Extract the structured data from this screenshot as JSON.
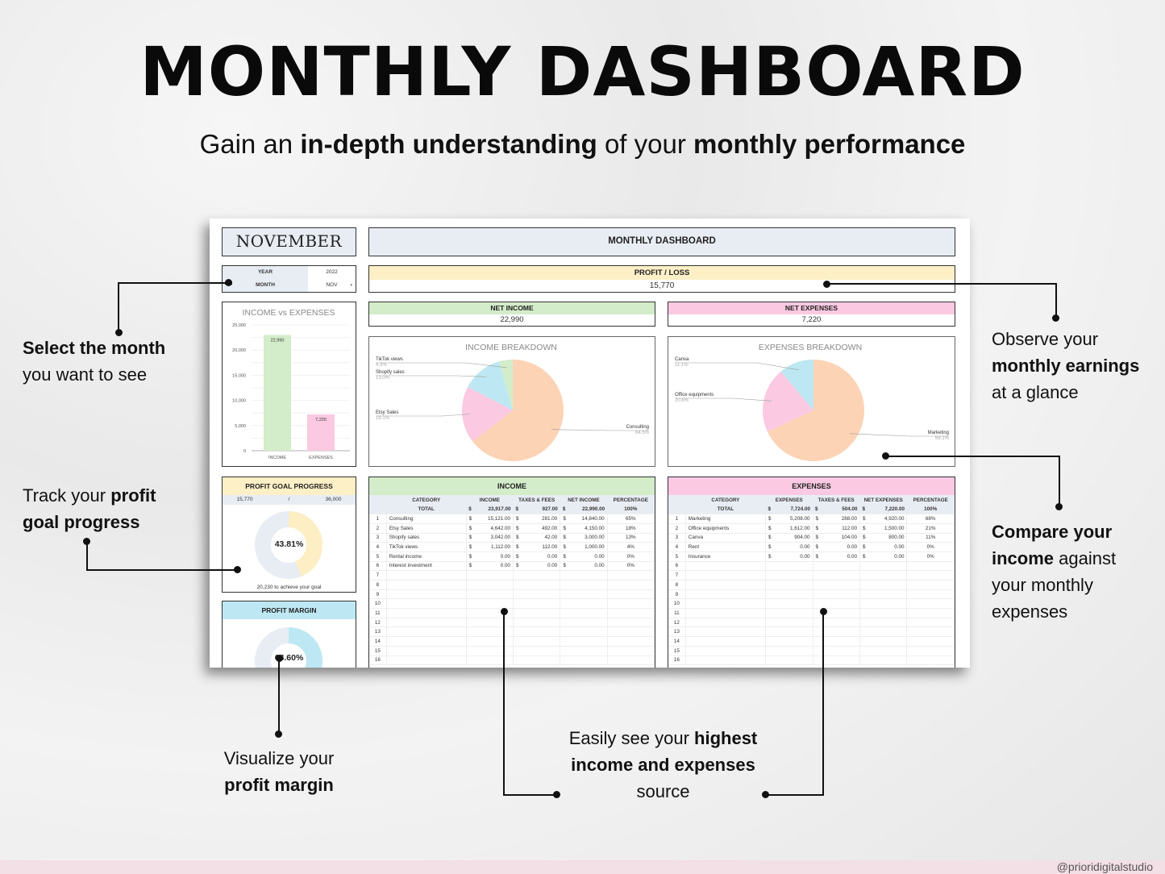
{
  "header": {
    "title": "MONTHLY DASHBOARD",
    "subtitle_parts": [
      {
        "text": "Gain an ",
        "bold": false
      },
      {
        "text": "in-depth understanding",
        "bold": true
      },
      {
        "text": " of your ",
        "bold": false
      },
      {
        "text": "monthly performance",
        "bold": true
      }
    ]
  },
  "dashboard": {
    "month_display": "NOVEMBER",
    "selector": {
      "year_label": "YEAR",
      "year_value": "2022",
      "month_label": "MONTH",
      "month_value": "NOV",
      "dropdown_icon": "▾"
    },
    "title": "MONTHLY DASHBOARD",
    "profit_loss": {
      "label": "PROFIT / LOSS",
      "value": "15,770"
    },
    "net_income": {
      "label": "NET INCOME",
      "value": "22,990"
    },
    "net_expenses": {
      "label": "NET EXPENSES",
      "value": "7,220"
    },
    "profit_goal": {
      "label": "PROFIT GOAL PROGRESS",
      "current": "15,770",
      "separator": "/",
      "goal": "36,000",
      "percent_label": "43.81%",
      "fraction": 0.4381,
      "remaining_text": "20,230  to achieve your goal",
      "fill_color": "#fdeec4",
      "track_color": "#e8edf4"
    },
    "profit_margin": {
      "label": "PROFIT MARGIN",
      "percent_label": "68.60%",
      "fraction": 0.686,
      "fill_color": "#bde8f3",
      "track_color": "#e8edf4"
    },
    "income_table": {
      "title": "INCOME",
      "columns": [
        "CATEGORY",
        "INCOME",
        "TAXES & FEES",
        "NET INCOME",
        "PERCENTAGE"
      ],
      "total": {
        "label": "TOTAL",
        "income": "23,917.00",
        "taxes": "927.00",
        "net": "22,990.00",
        "pct": "100%"
      },
      "rows": [
        {
          "n": "1",
          "category": "Consulting",
          "income": "15,121.00",
          "taxes": "281.00",
          "net": "14,840.00",
          "pct": "65%"
        },
        {
          "n": "2",
          "category": "Etsy Sales",
          "income": "4,642.00",
          "taxes": "492.00",
          "net": "4,150.00",
          "pct": "18%"
        },
        {
          "n": "3",
          "category": "Shopify sales",
          "income": "3,042.00",
          "taxes": "42.00",
          "net": "3,000.00",
          "pct": "13%"
        },
        {
          "n": "4",
          "category": "TikTok views",
          "income": "1,112.00",
          "taxes": "112.00",
          "net": "1,000.00",
          "pct": "4%"
        },
        {
          "n": "5",
          "category": "Rental income",
          "income": "0.00",
          "taxes": "0.00",
          "net": "0.00",
          "pct": "0%"
        },
        {
          "n": "6",
          "category": "Interest investment",
          "income": "0.00",
          "taxes": "0.00",
          "net": "0.00",
          "pct": "0%"
        },
        {
          "n": "7"
        },
        {
          "n": "8"
        },
        {
          "n": "9"
        },
        {
          "n": "10"
        },
        {
          "n": "11"
        },
        {
          "n": "12"
        },
        {
          "n": "13"
        },
        {
          "n": "14"
        },
        {
          "n": "15"
        },
        {
          "n": "16"
        }
      ]
    },
    "expenses_table": {
      "title": "EXPENSES",
      "columns": [
        "CATEGORY",
        "EXPENSES",
        "TAXES & FEES",
        "NET EXPENSES",
        "PERCENTAGE"
      ],
      "total": {
        "label": "TOTAL",
        "income": "7,724.00",
        "taxes": "504.00",
        "net": "7,220.00",
        "pct": "100%"
      },
      "rows": [
        {
          "n": "1",
          "category": "Marketing",
          "income": "5,208.00",
          "taxes": "288.00",
          "net": "4,920.00",
          "pct": "68%"
        },
        {
          "n": "2",
          "category": "Office equipments",
          "income": "1,612.00",
          "taxes": "112.00",
          "net": "1,500.00",
          "pct": "21%"
        },
        {
          "n": "3",
          "category": "Canva",
          "income": "904.00",
          "taxes": "104.00",
          "net": "800.00",
          "pct": "11%"
        },
        {
          "n": "4",
          "category": "Rent",
          "income": "0.00",
          "taxes": "0.00",
          "net": "0.00",
          "pct": "0%"
        },
        {
          "n": "5",
          "category": "Insurance",
          "income": "0.00",
          "taxes": "0.00",
          "net": "0.00",
          "pct": "0%"
        },
        {
          "n": "6"
        },
        {
          "n": "7"
        },
        {
          "n": "8"
        },
        {
          "n": "9"
        },
        {
          "n": "10"
        },
        {
          "n": "11"
        },
        {
          "n": "12"
        },
        {
          "n": "13"
        },
        {
          "n": "14"
        },
        {
          "n": "15"
        },
        {
          "n": "16"
        }
      ]
    },
    "currency_symbol": "$"
  },
  "chart_data": [
    {
      "type": "bar",
      "title": "INCOME vs EXPENSES",
      "categories": [
        "INCOME",
        "EXPENSES"
      ],
      "values": [
        22990,
        7220
      ],
      "data_labels": [
        "22,990",
        "7,220"
      ],
      "colors": [
        "#d3ecc9",
        "#fbc9e1"
      ],
      "ylim": [
        0,
        25000
      ],
      "yticks": [
        0,
        5000,
        10000,
        15000,
        20000,
        25000
      ],
      "ytick_labels": [
        "0",
        "5,000",
        "10,000",
        "15,000",
        "20,000",
        "25,000"
      ],
      "xlabel": "",
      "ylabel": "",
      "grid": true
    },
    {
      "type": "pie",
      "title": "INCOME BREAKDOWN",
      "slices": [
        {
          "label": "Consulting",
          "pct": "64.5%",
          "value": 64.5,
          "color": "#fdd3b5"
        },
        {
          "label": "Etsy Sales",
          "pct": "18.1%",
          "value": 18.1,
          "color": "#fbc9e1"
        },
        {
          "label": "Shopify sales",
          "pct": "13.0%",
          "value": 13.0,
          "color": "#bde8f3"
        },
        {
          "label": "TikTok views",
          "pct": "4.3%",
          "value": 4.3,
          "color": "#d3ecc9"
        }
      ]
    },
    {
      "type": "pie",
      "title": "EXPENSES BREAKDOWN",
      "slices": [
        {
          "label": "Marketing",
          "pct": "68.1%",
          "value": 68.1,
          "color": "#fdd3b5"
        },
        {
          "label": "Office equipments",
          "pct": "20.8%",
          "value": 20.8,
          "color": "#fbc9e1"
        },
        {
          "label": "Canva",
          "pct": "11.1%",
          "value": 11.1,
          "color": "#bde8f3"
        }
      ]
    }
  ],
  "annotations": {
    "select_month": [
      {
        "text": "Select the month",
        "bold": true
      },
      {
        "text": "you want to see",
        "bold": false
      }
    ],
    "goal_progress": [
      {
        "text": "Track your ",
        "bold": false
      },
      {
        "text": "profit",
        "bold": true
      },
      {
        "text": "goal progress",
        "bold": true
      }
    ],
    "profit_margin": [
      {
        "text": "Visualize your",
        "bold": false
      },
      {
        "text": "profit margin",
        "bold": true
      }
    ],
    "highest_source": [
      {
        "text": "Easily see your ",
        "bold": false
      },
      {
        "text": "highest",
        "bold": true
      },
      {
        "text": "income and expenses",
        "bold": true
      },
      {
        "text": "source",
        "bold": false
      }
    ],
    "monthly_earnings": [
      {
        "text": "Observe your",
        "bold": false
      },
      {
        "text": "monthly earnings",
        "bold": true
      },
      {
        "text": "at a glance",
        "bold": false
      }
    ],
    "compare": [
      {
        "text": "Compare your",
        "bold": true
      },
      {
        "text": "income",
        "bold": true
      },
      {
        "text": " against",
        "bold": false
      },
      {
        "text": "your monthly",
        "bold": false
      },
      {
        "text": "expenses",
        "bold": false
      }
    ]
  },
  "footer": {
    "handle": "@prioridigitalstudio"
  }
}
